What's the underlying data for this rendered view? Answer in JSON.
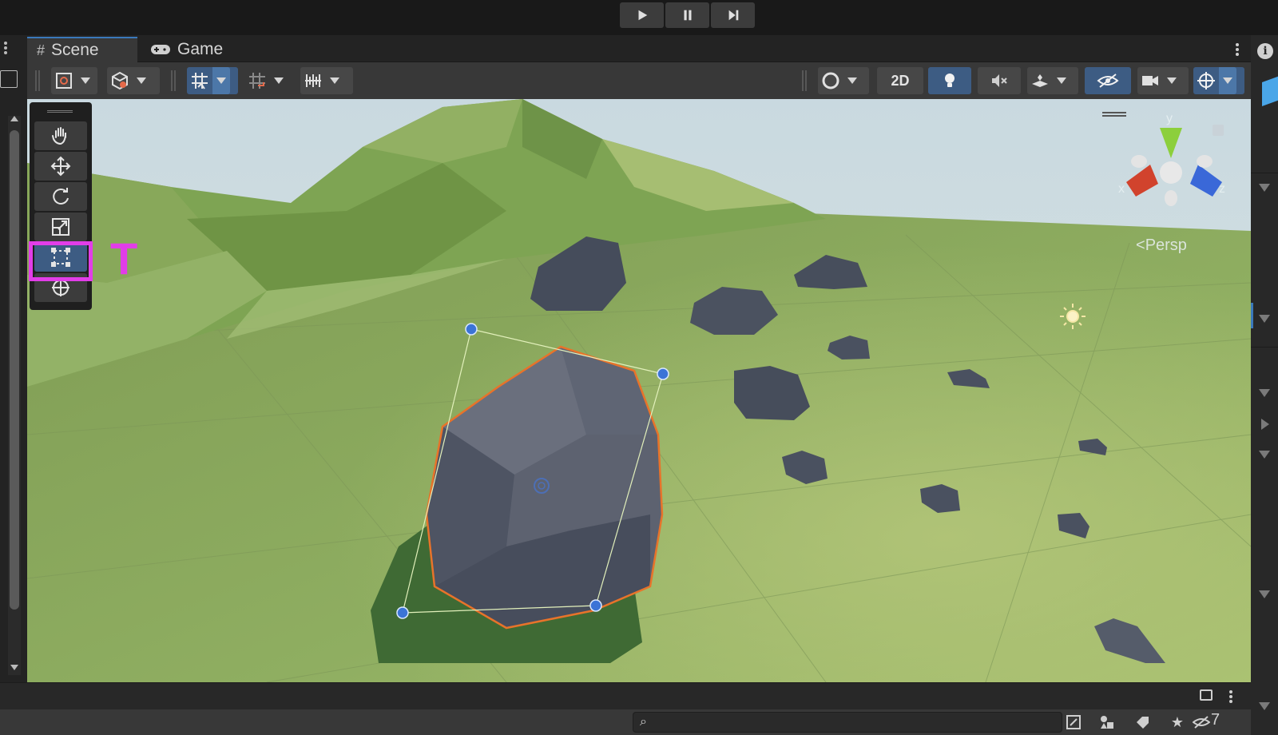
{
  "playbar": {
    "buttons": [
      {
        "name": "play-icon"
      },
      {
        "name": "pause-icon"
      },
      {
        "name": "step-icon"
      }
    ]
  },
  "tabs": [
    {
      "label": "Scene",
      "icon": "grid-hash-icon",
      "active": true
    },
    {
      "label": "Game",
      "icon": "gamepad-icon",
      "active": false
    }
  ],
  "toolbar": {
    "twod_label": "2D"
  },
  "tools": [
    {
      "name": "hand-tool",
      "icon": "hand-icon"
    },
    {
      "name": "move-tool",
      "icon": "move-arrows-icon"
    },
    {
      "name": "rotate-tool",
      "icon": "rotate-icon"
    },
    {
      "name": "scale-tool",
      "icon": "scale-icon"
    },
    {
      "name": "rect-tool",
      "icon": "rect-transform-icon",
      "selected": true
    },
    {
      "name": "transform-tool",
      "icon": "transform-icon"
    }
  ],
  "annotation": {
    "hotkey": "T",
    "color": "#e23de8"
  },
  "gizmo": {
    "y_label": "y",
    "x_label": "x",
    "z_label": "z",
    "projection": "Persp"
  },
  "bottom": {
    "search_placeholder": "",
    "hidden_count": "7"
  },
  "colors": {
    "accent": "#3a79bb",
    "selected_tool": "#3d5c83",
    "outline": "#e8732a",
    "handle": "#3b74d6"
  }
}
